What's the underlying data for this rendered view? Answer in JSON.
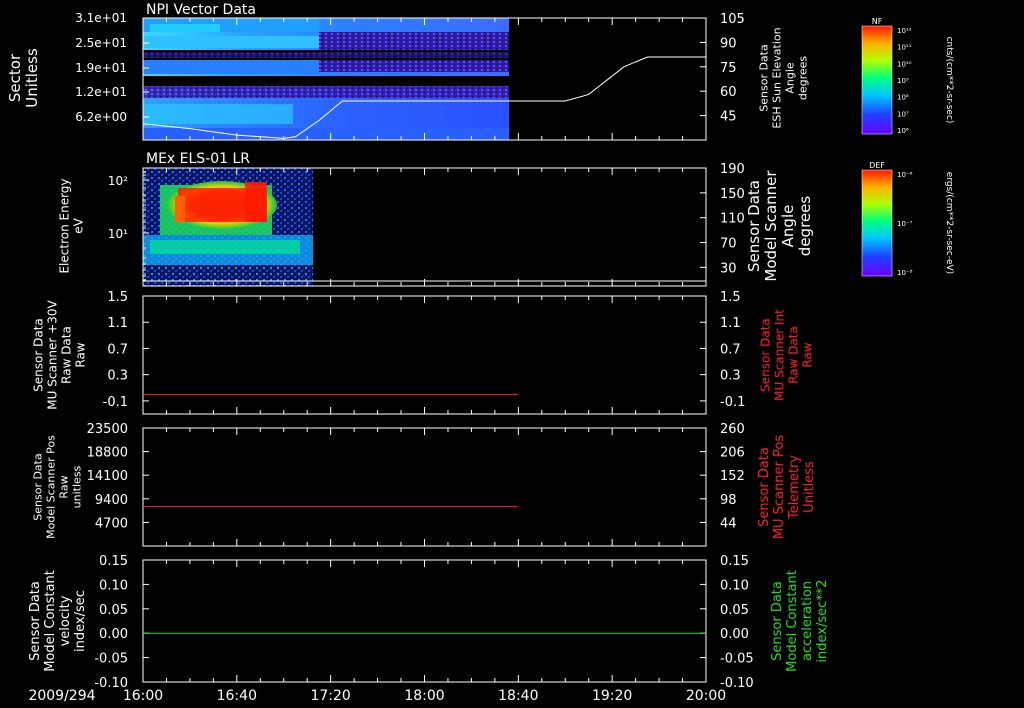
{
  "date_label": "2009/294",
  "x_ticks": [
    "16:00",
    "16:40",
    "17:20",
    "18:00",
    "18:40",
    "19:20",
    "20:00"
  ],
  "colors": {
    "background": "#000000",
    "axes": "#ffffff",
    "red_trace": "#ff2020",
    "green_trace": "#20e020",
    "white_trace": "#ffffff"
  },
  "colorbars": [
    {
      "tag": "NF",
      "title": "cnts/(cm**2-sr-sec)",
      "ticks": [
        "10¹²",
        "10¹¹",
        "10¹⁰",
        "10⁹",
        "10⁸",
        "10⁷",
        "10⁶"
      ]
    },
    {
      "tag": "DEF",
      "title": "ergs/(cm**2-sr-sec-eV)",
      "ticks": [
        "10⁻⁶",
        "10⁻⁷",
        "10⁻⁸"
      ]
    }
  ],
  "chart_data": [
    {
      "type": "heatmap",
      "title": "NPI Vector Data",
      "ylabel": [
        "Sector",
        "Unitless"
      ],
      "yticks": [
        "3.1e+01",
        "2.5e+01",
        "1.9e+01",
        "1.2e+01",
        "6.2e+00"
      ],
      "right_ylabel": [
        "Sensor Data",
        "ESH Sun Elevation",
        "Angle",
        "degrees"
      ],
      "right_yticks": [
        105,
        90,
        75,
        60,
        45
      ],
      "right_ylim": [
        30,
        105
      ],
      "x": [
        "16:00",
        "20:00"
      ],
      "data_end": "18:40",
      "overlay_line": {
        "name": "ESH Sun Elevation Angle",
        "points": [
          [
            "16:00",
            40
          ],
          [
            "16:20",
            37
          ],
          [
            "16:40",
            33
          ],
          [
            "17:00",
            31
          ],
          [
            "17:05",
            32
          ],
          [
            "17:15",
            42
          ],
          [
            "17:25",
            54
          ],
          [
            "18:40",
            54
          ],
          [
            "19:00",
            54
          ],
          [
            "19:10",
            58
          ],
          [
            "19:25",
            75
          ],
          [
            "19:35",
            81
          ],
          [
            "20:00",
            81
          ]
        ]
      }
    },
    {
      "type": "heatmap",
      "title": "MEx ELS-01 LR",
      "ylabel": [
        "Electron Energy",
        "eV"
      ],
      "yticks": [
        "10²",
        "10¹"
      ],
      "ylog": true,
      "right_ylabel": [
        "Sensor Data",
        "Model Scanner",
        "Angle",
        "degrees"
      ],
      "right_yticks": [
        190,
        150,
        110,
        70,
        30
      ],
      "right_ylim": [
        0,
        190
      ],
      "x": [
        "16:00",
        "20:00"
      ],
      "data_end": "17:10",
      "overlay_line": {
        "name": "Model Scanner Angle",
        "points": [
          [
            "16:00",
            8
          ],
          [
            "20:00",
            8
          ]
        ]
      }
    },
    {
      "type": "line",
      "ylabel": [
        "Sensor Data",
        "MU Scanner +30V",
        "Raw Data",
        "Raw"
      ],
      "ylim": [
        -0.3,
        1.5
      ],
      "yticks": [
        1.5,
        1.1,
        0.7,
        0.3,
        -0.1
      ],
      "right_ylabel": [
        "Sensor Data",
        "MU Scanner Int",
        "Raw Data",
        "Raw"
      ],
      "right_yticks": [
        1.5,
        1.1,
        0.7,
        0.3,
        -0.1
      ],
      "series": [
        {
          "values": [
            [
              "16:00",
              0.0
            ],
            [
              "18:40",
              0.0
            ]
          ]
        }
      ]
    },
    {
      "type": "line",
      "ylabel": [
        "Sensor Data",
        "Model Scanner Pos",
        "Raw",
        "unitless"
      ],
      "ylim": [
        0,
        23500
      ],
      "yticks": [
        23500,
        18800,
        14100,
        9400,
        4700
      ],
      "right_ylabel": [
        "Sensor Data",
        "MU Scanner Pos",
        "Telemetry",
        "Unitless"
      ],
      "right_yticks": [
        260,
        206,
        152,
        98,
        44
      ],
      "series": [
        {
          "values": [
            [
              "16:00",
              7850
            ],
            [
              "18:40",
              7850
            ]
          ]
        }
      ]
    },
    {
      "type": "line",
      "ylabel": [
        "Sensor Data",
        "Model Constant",
        "velocity",
        "index/sec"
      ],
      "ylim": [
        -0.1,
        0.15
      ],
      "yticks": [
        "0.15",
        "0.10",
        "0.05",
        "0.00",
        "-0.05",
        "-0.10"
      ],
      "right_ylabel": [
        "Sensor Data",
        "Model Constant",
        "acceleration",
        "index/sec**2"
      ],
      "right_yticks": [
        "0.15",
        "0.10",
        "0.05",
        "0.00",
        "-0.05",
        "-0.10"
      ],
      "series": [
        {
          "values": [
            [
              "16:00",
              0.0
            ],
            [
              "20:00",
              0.0
            ]
          ]
        }
      ]
    }
  ]
}
